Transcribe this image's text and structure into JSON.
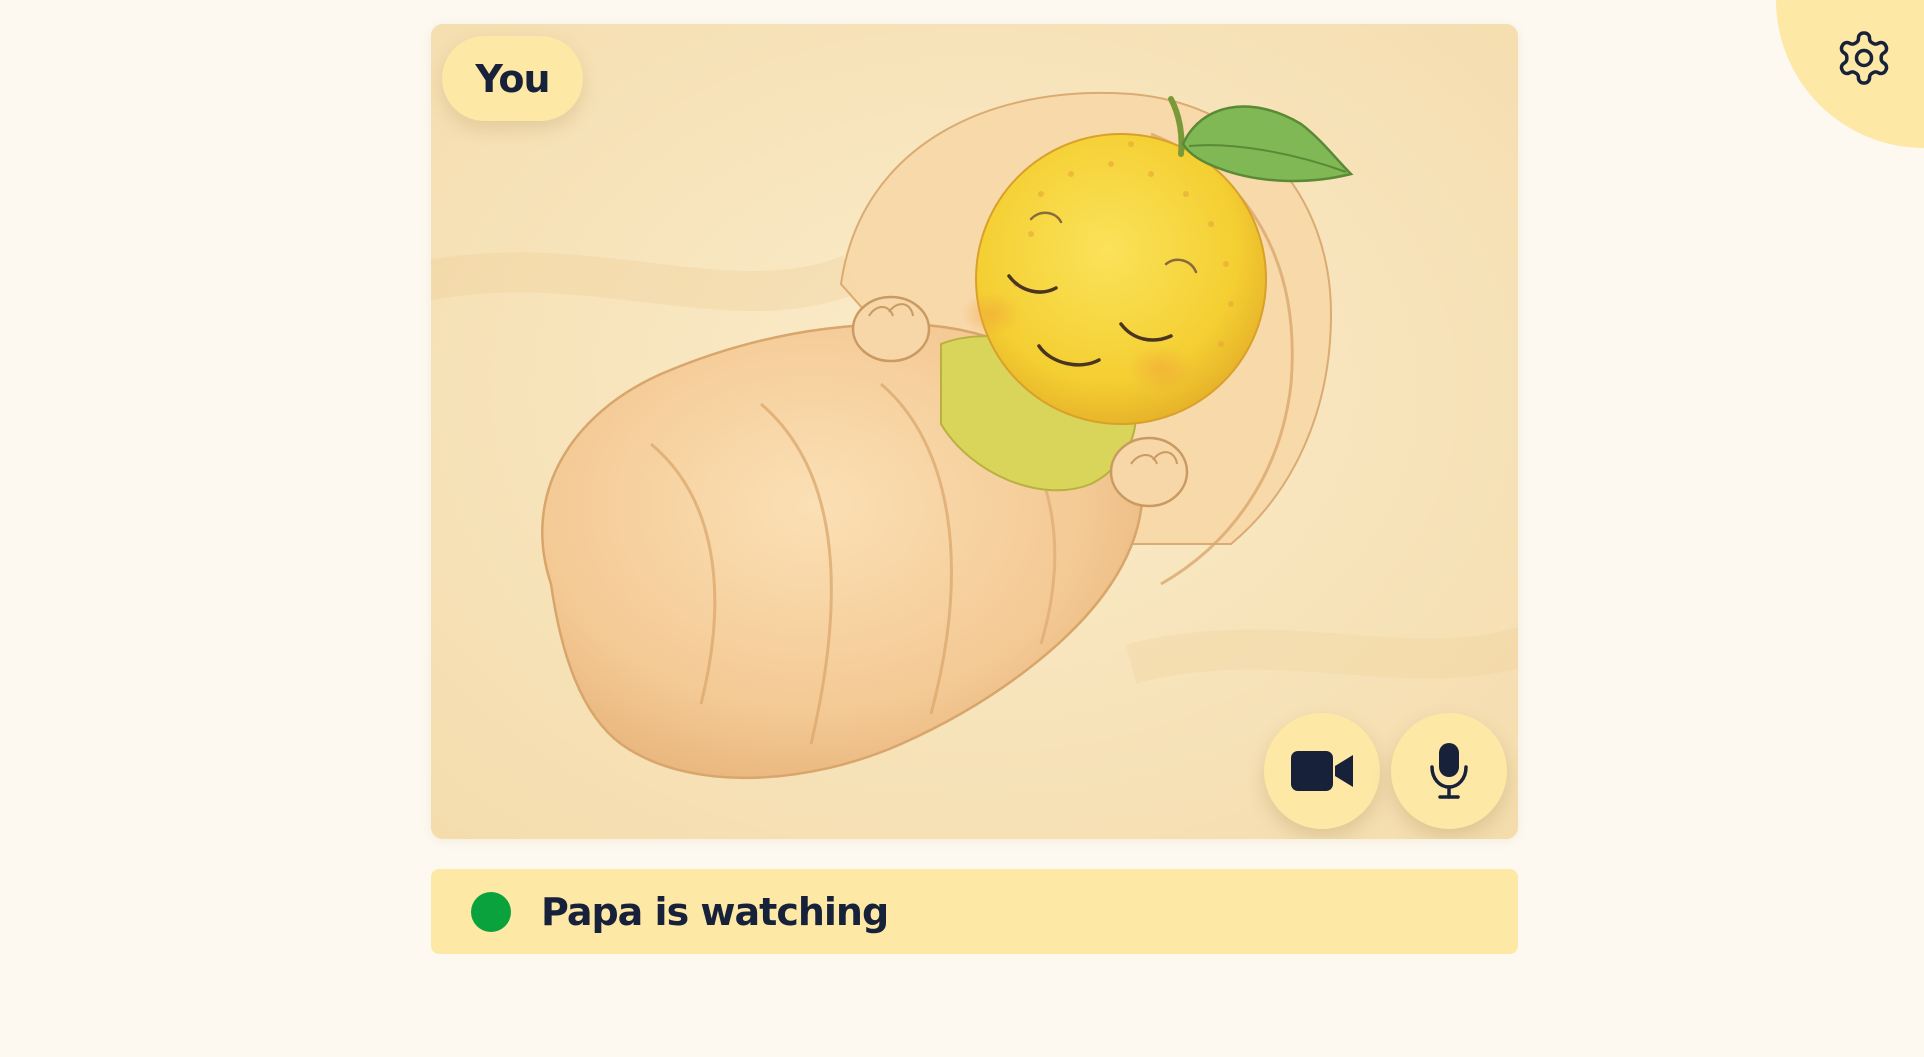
{
  "video": {
    "self_label": "You",
    "illustration": "sleeping-orange-baby-in-blanket"
  },
  "controls": {
    "camera_icon": "video-camera-icon",
    "mic_icon": "microphone-icon"
  },
  "status": {
    "text": "Papa is watching",
    "indicator_color": "#0aa23c"
  },
  "settings": {
    "icon": "gear-icon"
  },
  "colors": {
    "background": "#fdf9f1",
    "accent": "#fee8a6",
    "ink": "#17223a"
  }
}
